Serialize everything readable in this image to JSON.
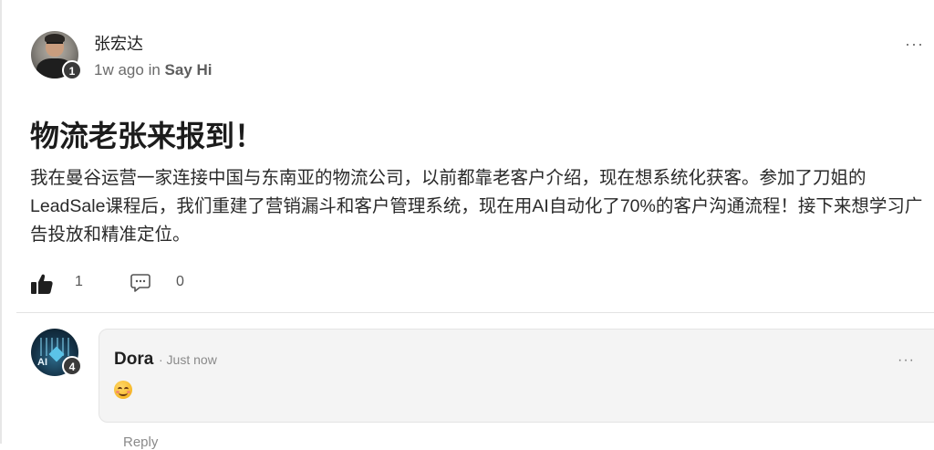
{
  "post": {
    "author": "张宏达",
    "author_level": "1",
    "time_ago": "1w ago",
    "in_label": "in",
    "category": "Say Hi",
    "more": "···",
    "title": "物流老张来报到！",
    "body": "我在曼谷运营一家连接中国与东南亚的物流公司，以前都靠老客户介绍，现在想系统化获客。参加了刀姐的LeadSale课程后，我们重建了营销漏斗和客户管理系统，现在用AI自动化了70%的客户沟通流程！接下来想学习广告投放和精准定位。",
    "like_count": "1",
    "comment_count": "0"
  },
  "comment": {
    "author": "Dora",
    "author_level": "4",
    "avatar_text": "AI",
    "time": "· Just now",
    "more": "···",
    "reply_hint": "Reply"
  },
  "icons": {
    "like": "thumbs-up-icon",
    "comment": "comment-bubble-icon",
    "emoji": "smiling-face-emoji"
  },
  "colors": {
    "text_primary": "#1f1f1f",
    "text_muted": "#6b6b6b",
    "badge": "#3a3a3a",
    "comment_bg": "#f4f4f4"
  }
}
